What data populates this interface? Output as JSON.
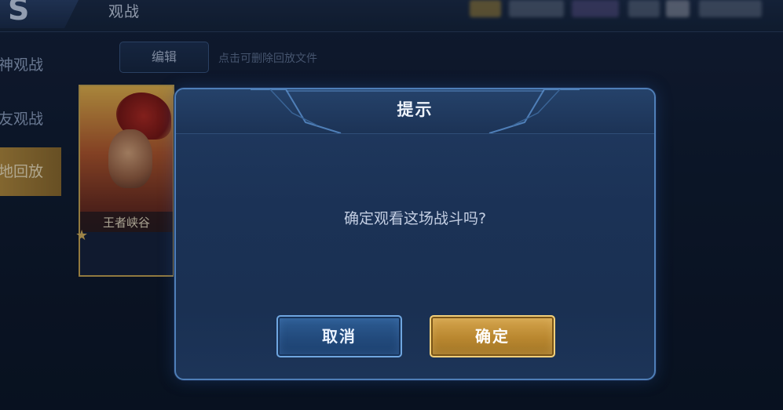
{
  "header": {
    "back_glyph": "S",
    "title": "观战"
  },
  "sidebar": {
    "items": [
      {
        "label": "神观战"
      },
      {
        "label": "友观战"
      },
      {
        "label": "地回放"
      }
    ]
  },
  "toolbar": {
    "edit_label": "编辑",
    "edit_hint": "点击可删除回放文件"
  },
  "replay_card": {
    "map_name": "王者峡谷"
  },
  "dialog": {
    "title": "提示",
    "message": "确定观看这场战斗吗?",
    "cancel_label": "取消",
    "confirm_label": "确定"
  },
  "colors": {
    "dialog_border": "#4f7fb8",
    "cancel_button": "#2e5e95",
    "confirm_button": "#d6a64f",
    "active_tab": "#b48a3a"
  }
}
